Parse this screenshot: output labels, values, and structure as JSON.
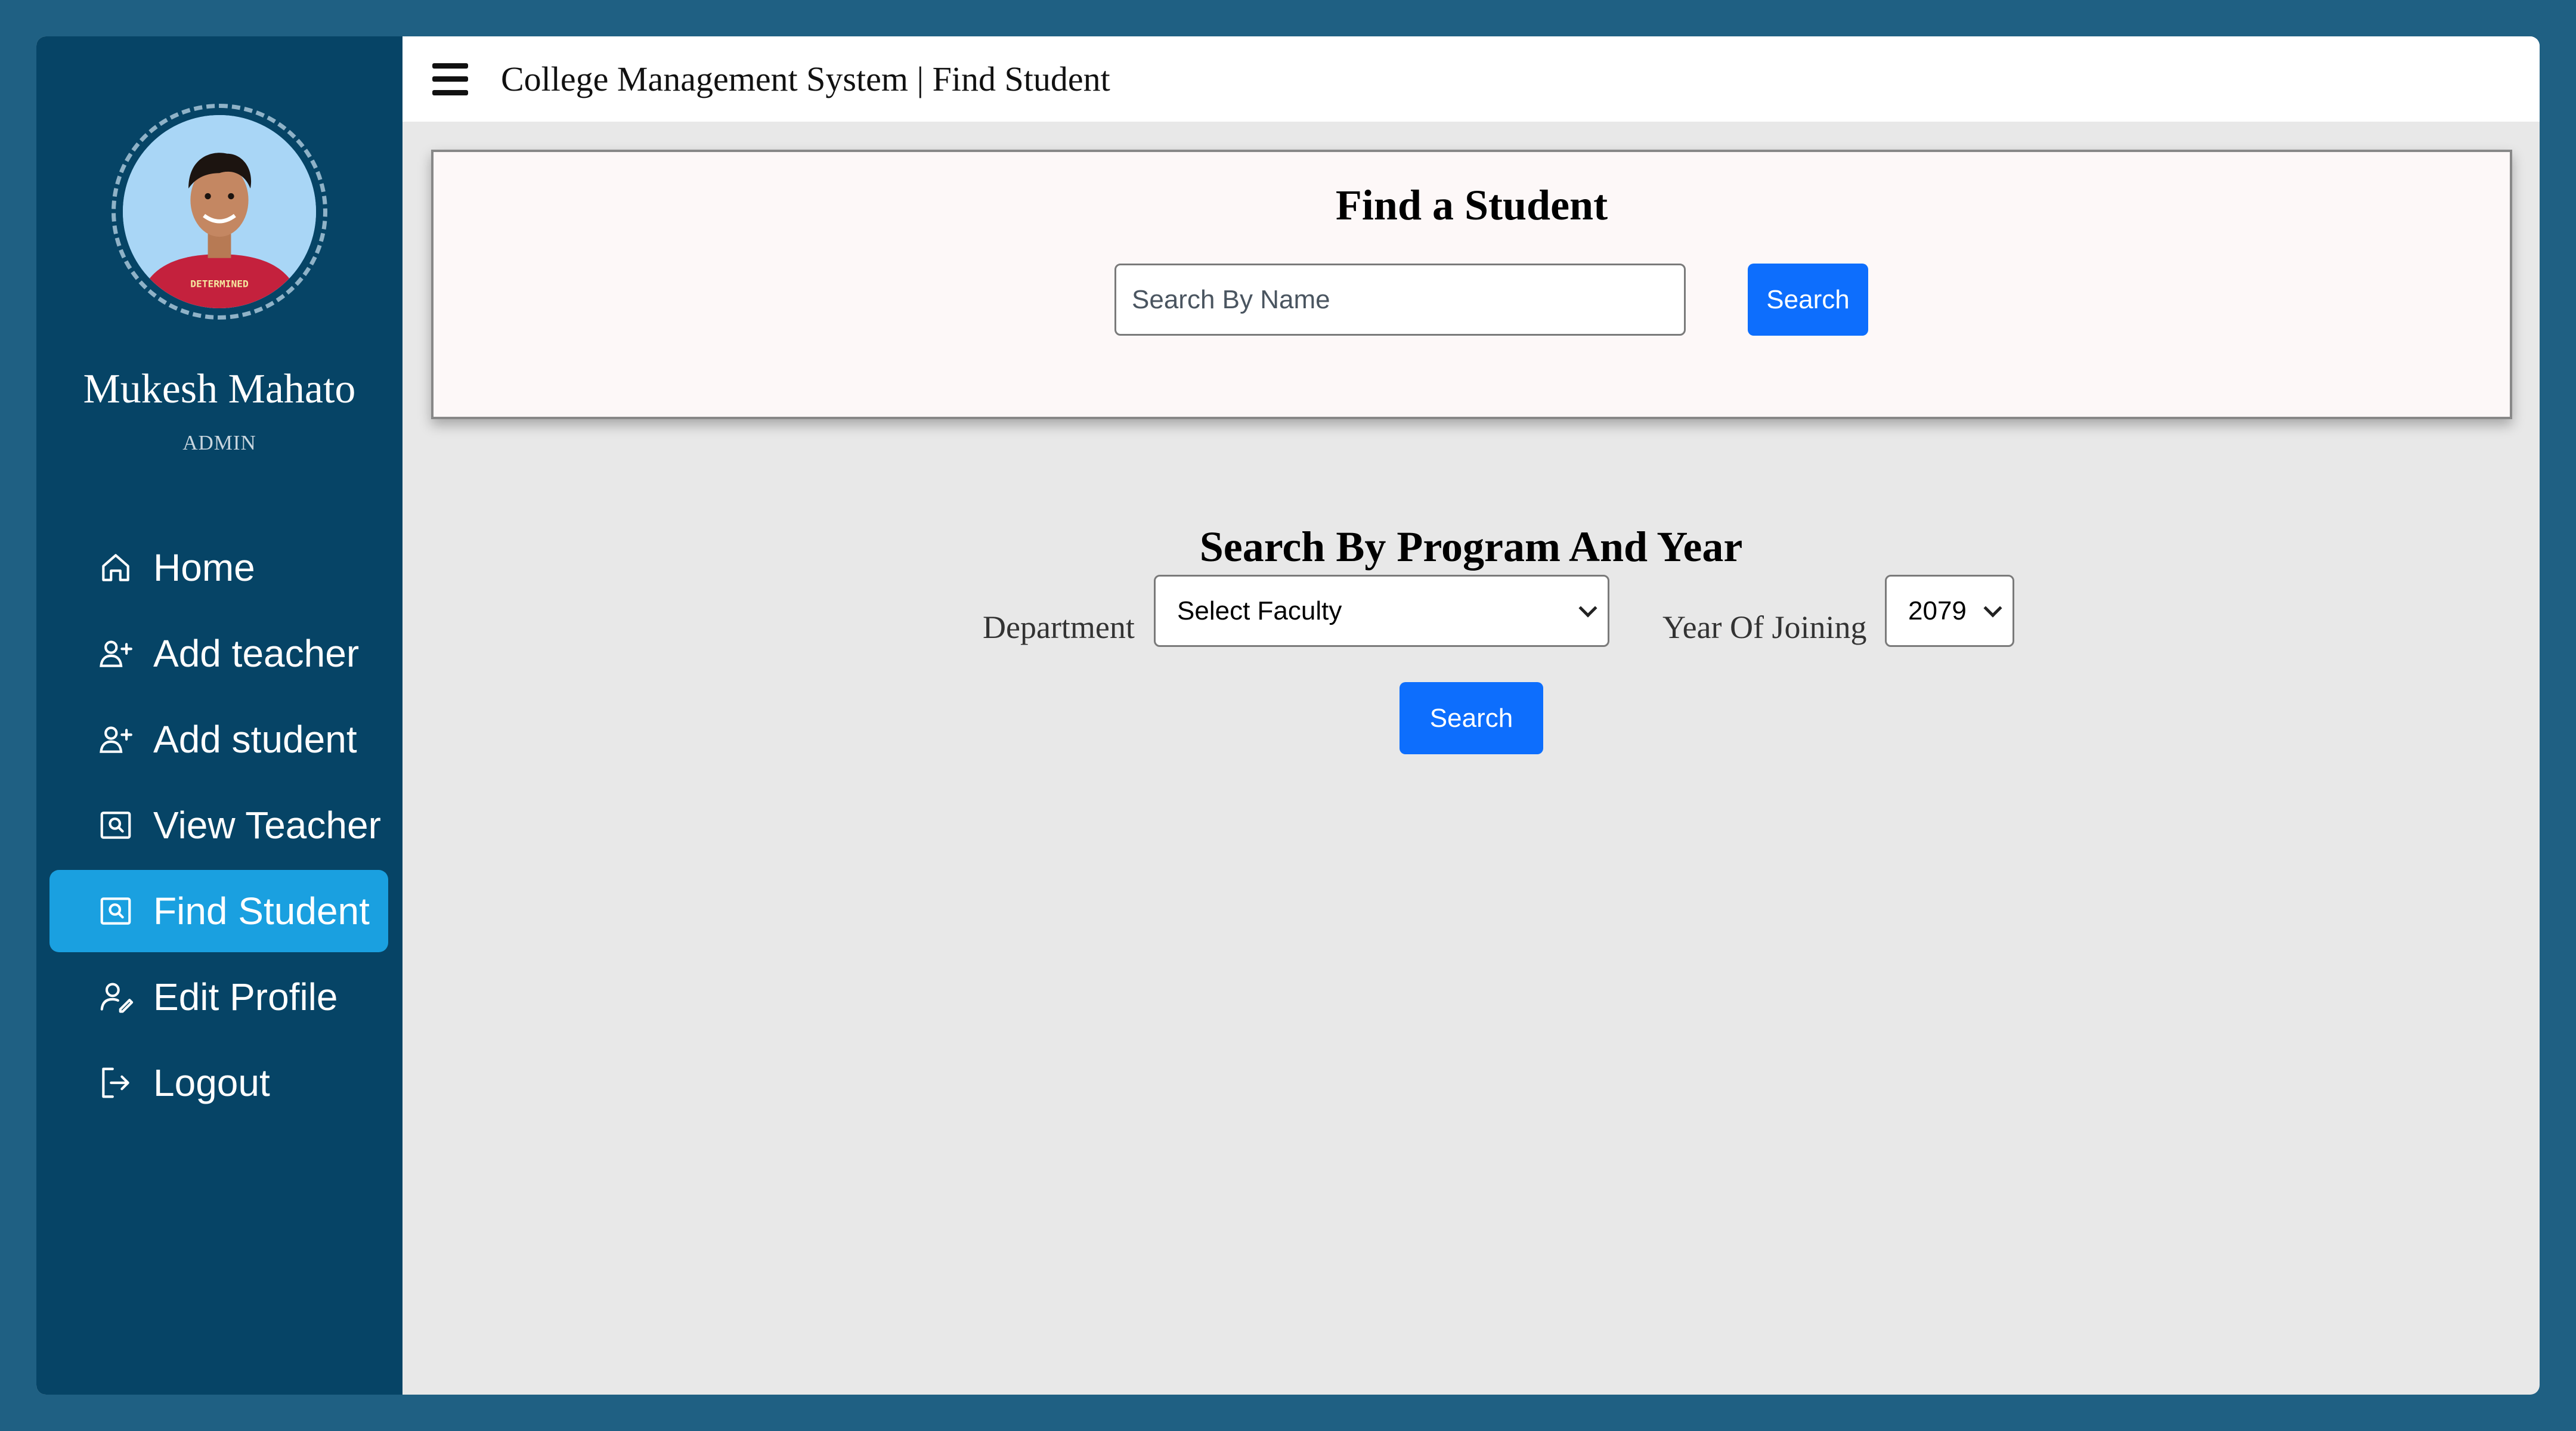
{
  "window": {
    "title": "College Management System | Find Student"
  },
  "user": {
    "name": "Mukesh Mahato",
    "role": "ADMIN",
    "shirt_text": "DETERMINED"
  },
  "sidebar": {
    "items": [
      {
        "label": "Home",
        "icon": "home-icon",
        "active": false
      },
      {
        "label": "Add teacher",
        "icon": "person-add-icon",
        "active": false
      },
      {
        "label": "Add student",
        "icon": "person-add-icon",
        "active": false
      },
      {
        "label": "View Teacher",
        "icon": "person-search-icon",
        "active": false
      },
      {
        "label": "Find Student",
        "icon": "person-search-icon",
        "active": true
      },
      {
        "label": "Edit Profile",
        "icon": "person-edit-icon",
        "active": false
      },
      {
        "label": "Logout",
        "icon": "logout-icon",
        "active": false
      }
    ]
  },
  "find_card": {
    "title": "Find a Student",
    "search_placeholder": "Search By Name",
    "search_value": "",
    "search_button": "Search"
  },
  "program_search": {
    "title": "Search By Program And Year",
    "department_label": "Department",
    "department_selected": "Select Faculty",
    "year_label": "Year Of Joining",
    "year_selected": "2079",
    "search_button": "Search"
  },
  "colors": {
    "page_bg": "#1f6083",
    "sidebar_bg": "#064466",
    "active_item": "#1aa0e0",
    "primary_button": "#0d6efd",
    "content_bg": "#e8e8e8",
    "card_bg": "#fdf8f8"
  }
}
